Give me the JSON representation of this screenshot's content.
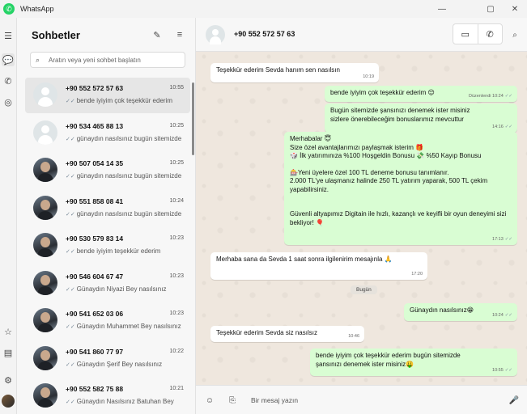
{
  "app": {
    "title": "WhatsApp",
    "logo_icon": "whatsapp-logo-icon"
  },
  "window_controls": [
    "—",
    "▢",
    "✕"
  ],
  "sidebar_title": "Sohbetler",
  "search": {
    "placeholder": "Aratın veya yeni sohbet başlatın"
  },
  "chats": [
    {
      "name": "+90 552 572 57 63",
      "time": "10:55",
      "preview": "bende iyiyim çok teşekkür ederim",
      "avatar": "default",
      "active": true
    },
    {
      "name": "+90 534 465 88 13",
      "time": "10:25",
      "preview": "günaydın nasılsınız bugün sitemizde",
      "avatar": "default",
      "active": false
    },
    {
      "name": "+90 507 054 14 35",
      "time": "10:25",
      "preview": "günaydın nasılsınız bugün sitemizde",
      "avatar": "photo",
      "active": false
    },
    {
      "name": "+90 551 858 08 41",
      "time": "10:24",
      "preview": "günaydın nasılsınız bugün sitemizde",
      "avatar": "photo",
      "active": false
    },
    {
      "name": "+90 530 579 83 14",
      "time": "10:23",
      "preview": "bende iyiyim teşekkür ederim",
      "avatar": "photo",
      "active": false
    },
    {
      "name": "+90 546 604 67 47",
      "time": "10:23",
      "preview": "Günaydın Niyazi Bey nasılsınız",
      "avatar": "photo",
      "active": false
    },
    {
      "name": "+90 541 652 03 06",
      "time": "10:23",
      "preview": "Günaydın Muhammet Bey nasılsınız",
      "avatar": "photo",
      "active": false
    },
    {
      "name": "+90 541 860 77 97",
      "time": "10:22",
      "preview": "Günaydın Şerif Bey nasılsınız",
      "avatar": "photo",
      "active": false
    },
    {
      "name": "+90 552 582 75 88",
      "time": "10:21",
      "preview": "Günaydın Nasılsınız Batuhan Bey",
      "avatar": "photo",
      "active": false
    }
  ],
  "conversation": {
    "contact": "+90 552 572 57 63",
    "messages": [
      {
        "dir": "in",
        "text": "Teşekkür ederim Sevda hanım sen nasılsın",
        "time": "10:19"
      },
      {
        "dir": "out",
        "text": "bende iyiyim çok teşekkür ederim 😌",
        "time": "Düzenlendi 10:24"
      },
      {
        "dir": "out",
        "text": "Bugün sitemizde şansınızı denemek ister misiniz sizlere önerebileceğim bonuslarımız mevcuttur",
        "time": "14:16"
      },
      {
        "dir": "out",
        "lines": [
          "Merhabalar 😇",
          "Size özel avantajlarımızı paylaşmak isterim 🎁",
          "🎲 İlk yatırımınıza %100 Hoşgeldin Bonusu 💸 %50 Kayıp Bonusu",
          "",
          "🎰Yeni üyelere özel 100 TL deneme bonusu tanımlanır.",
          "2.000 TL'ye ulaşmanız halinde 250 TL yatırım yaparak,  500 TL çekim yapabilirsiniz.",
          "",
          "",
          "Güvenli altyapımız Digitain ile hızlı, kazançlı ve keyifli bir oyun deneyimi sizi bekliyor! 🎈"
        ],
        "time": "17:13"
      },
      {
        "dir": "in",
        "text": "Merhaba sana da Sevda 1 saat sonra ilgilenirim mesajınla 🙏",
        "time": "17:20"
      },
      {
        "dir": "out",
        "text": "Günaydın nasılsınız😁",
        "time": "10:24"
      },
      {
        "dir": "in",
        "text": "Teşekkür ederim Sevda siz nasılsız",
        "time": "10:46"
      },
      {
        "dir": "out",
        "text": "bende iyiyim çok teşekkür ederim bugün sitemizde şansınızı denemek ister misiniz🤑",
        "time": "10:55"
      }
    ],
    "day_label": "Bugün",
    "composer_placeholder": "Bir mesaj yazın"
  },
  "colors": {
    "outgoing": "#d9fdd3",
    "incoming": "#ffffff",
    "wallpaper": "#efe7de",
    "accent": "#25d366"
  }
}
